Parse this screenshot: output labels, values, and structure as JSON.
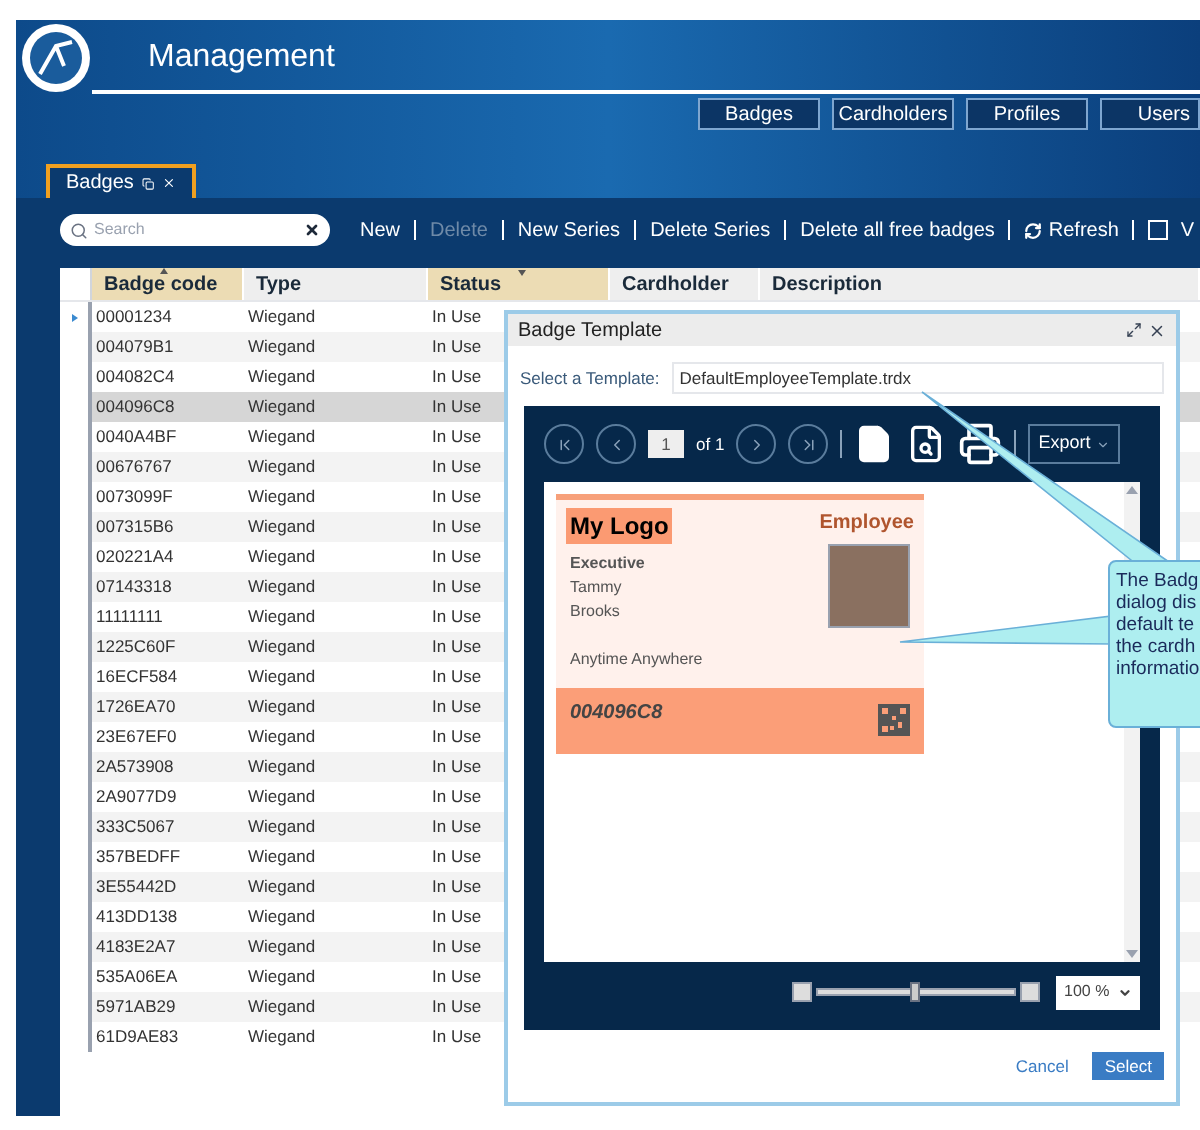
{
  "app": {
    "title": "Management"
  },
  "nav": [
    {
      "label": "Badges"
    },
    {
      "label": "Cardholders"
    },
    {
      "label": "Profiles"
    },
    {
      "label": "Users"
    }
  ],
  "doc_tabs": [
    {
      "label": "Badges",
      "selected": true
    }
  ],
  "search": {
    "placeholder": "Search"
  },
  "toolbar": [
    {
      "kind": "text",
      "label": "New",
      "disabled": false
    },
    {
      "kind": "text",
      "label": "Delete",
      "disabled": true
    },
    {
      "kind": "text",
      "label": "New Series",
      "disabled": false
    },
    {
      "kind": "text",
      "label": "Delete Series",
      "disabled": false
    },
    {
      "kind": "text",
      "label": "Delete all free badges",
      "disabled": false
    },
    {
      "kind": "refresh",
      "label": "Refresh",
      "disabled": false
    },
    {
      "kind": "checkbox",
      "label": "V",
      "checked": false
    }
  ],
  "table": {
    "columns": [
      {
        "label": "Badge code",
        "sort_up": true,
        "sort_down": false
      },
      {
        "label": "Type",
        "sort_up": false,
        "sort_down": false
      },
      {
        "label": "Status",
        "sort_up": false,
        "sort_down": true
      },
      {
        "label": "Cardholder",
        "sort_up": false,
        "sort_down": false
      },
      {
        "label": "Description",
        "sort_up": false,
        "sort_down": false
      }
    ],
    "rows": [
      {
        "cells": [
          "00001234",
          "Wiegand",
          "In Use"
        ],
        "current": true,
        "selected": false
      },
      {
        "cells": [
          "004079B1",
          "Wiegand",
          "In Use"
        ],
        "current": false,
        "selected": false
      },
      {
        "cells": [
          "004082C4",
          "Wiegand",
          "In Use"
        ],
        "current": false,
        "selected": false
      },
      {
        "cells": [
          "004096C8",
          "Wiegand",
          "In Use"
        ],
        "current": false,
        "selected": true
      },
      {
        "cells": [
          "0040A4BF",
          "Wiegand",
          "In Use"
        ],
        "current": false,
        "selected": false
      },
      {
        "cells": [
          "00676767",
          "Wiegand",
          "In Use"
        ],
        "current": false,
        "selected": false
      },
      {
        "cells": [
          "0073099F",
          "Wiegand",
          "In Use"
        ],
        "current": false,
        "selected": false
      },
      {
        "cells": [
          "007315B6",
          "Wiegand",
          "In Use"
        ],
        "current": false,
        "selected": false
      },
      {
        "cells": [
          "020221A4",
          "Wiegand",
          "In Use"
        ],
        "current": false,
        "selected": false
      },
      {
        "cells": [
          "07143318",
          "Wiegand",
          "In Use"
        ],
        "current": false,
        "selected": false
      },
      {
        "cells": [
          "11111111",
          "Wiegand",
          "In Use"
        ],
        "current": false,
        "selected": false
      },
      {
        "cells": [
          "1225C60F",
          "Wiegand",
          "In Use"
        ],
        "current": false,
        "selected": false
      },
      {
        "cells": [
          "16ECF584",
          "Wiegand",
          "In Use"
        ],
        "current": false,
        "selected": false
      },
      {
        "cells": [
          "1726EA70",
          "Wiegand",
          "In Use"
        ],
        "current": false,
        "selected": false
      },
      {
        "cells": [
          "23E67EF0",
          "Wiegand",
          "In Use"
        ],
        "current": false,
        "selected": false
      },
      {
        "cells": [
          "2A573908",
          "Wiegand",
          "In Use"
        ],
        "current": false,
        "selected": false
      },
      {
        "cells": [
          "2A9077D9",
          "Wiegand",
          "In Use"
        ],
        "current": false,
        "selected": false
      },
      {
        "cells": [
          "333C5067",
          "Wiegand",
          "In Use"
        ],
        "current": false,
        "selected": false
      },
      {
        "cells": [
          "357BEDFF",
          "Wiegand",
          "In Use"
        ],
        "current": false,
        "selected": false
      },
      {
        "cells": [
          "3E55442D",
          "Wiegand",
          "In Use"
        ],
        "current": false,
        "selected": false
      },
      {
        "cells": [
          "413DD138",
          "Wiegand",
          "In Use"
        ],
        "current": false,
        "selected": false
      },
      {
        "cells": [
          "4183E2A7",
          "Wiegand",
          "In Use"
        ],
        "current": false,
        "selected": false
      },
      {
        "cells": [
          "535A06EA",
          "Wiegand",
          "In Use"
        ],
        "current": false,
        "selected": false
      },
      {
        "cells": [
          "5971AB29",
          "Wiegand",
          "In Use"
        ],
        "current": false,
        "selected": false
      },
      {
        "cells": [
          "61D9AE83",
          "Wiegand",
          "In Use"
        ],
        "current": false,
        "selected": false
      }
    ]
  },
  "dialog": {
    "title": "Badge Template",
    "template_label": "Select a Template:",
    "template_value": "DefaultEmployeeTemplate.trdx",
    "pager": {
      "page": "1",
      "of": "of 1"
    },
    "export": "Export",
    "card": {
      "logo": "My Logo",
      "role": "Employee",
      "job": "Executive",
      "first_name": "Tammy",
      "last_name": "Brooks",
      "slogan": "Anytime Anywhere",
      "code": "004096C8"
    },
    "zoom": {
      "level": 0.5,
      "value": "100 %"
    },
    "buttons": [
      {
        "kind": "link",
        "label": "Cancel"
      },
      {
        "kind": "primary",
        "label": "Select"
      }
    ]
  },
  "callout": {
    "lines": [
      "The Badg",
      "dialog dis",
      "default te",
      "the cardh",
      "informatio"
    ]
  }
}
